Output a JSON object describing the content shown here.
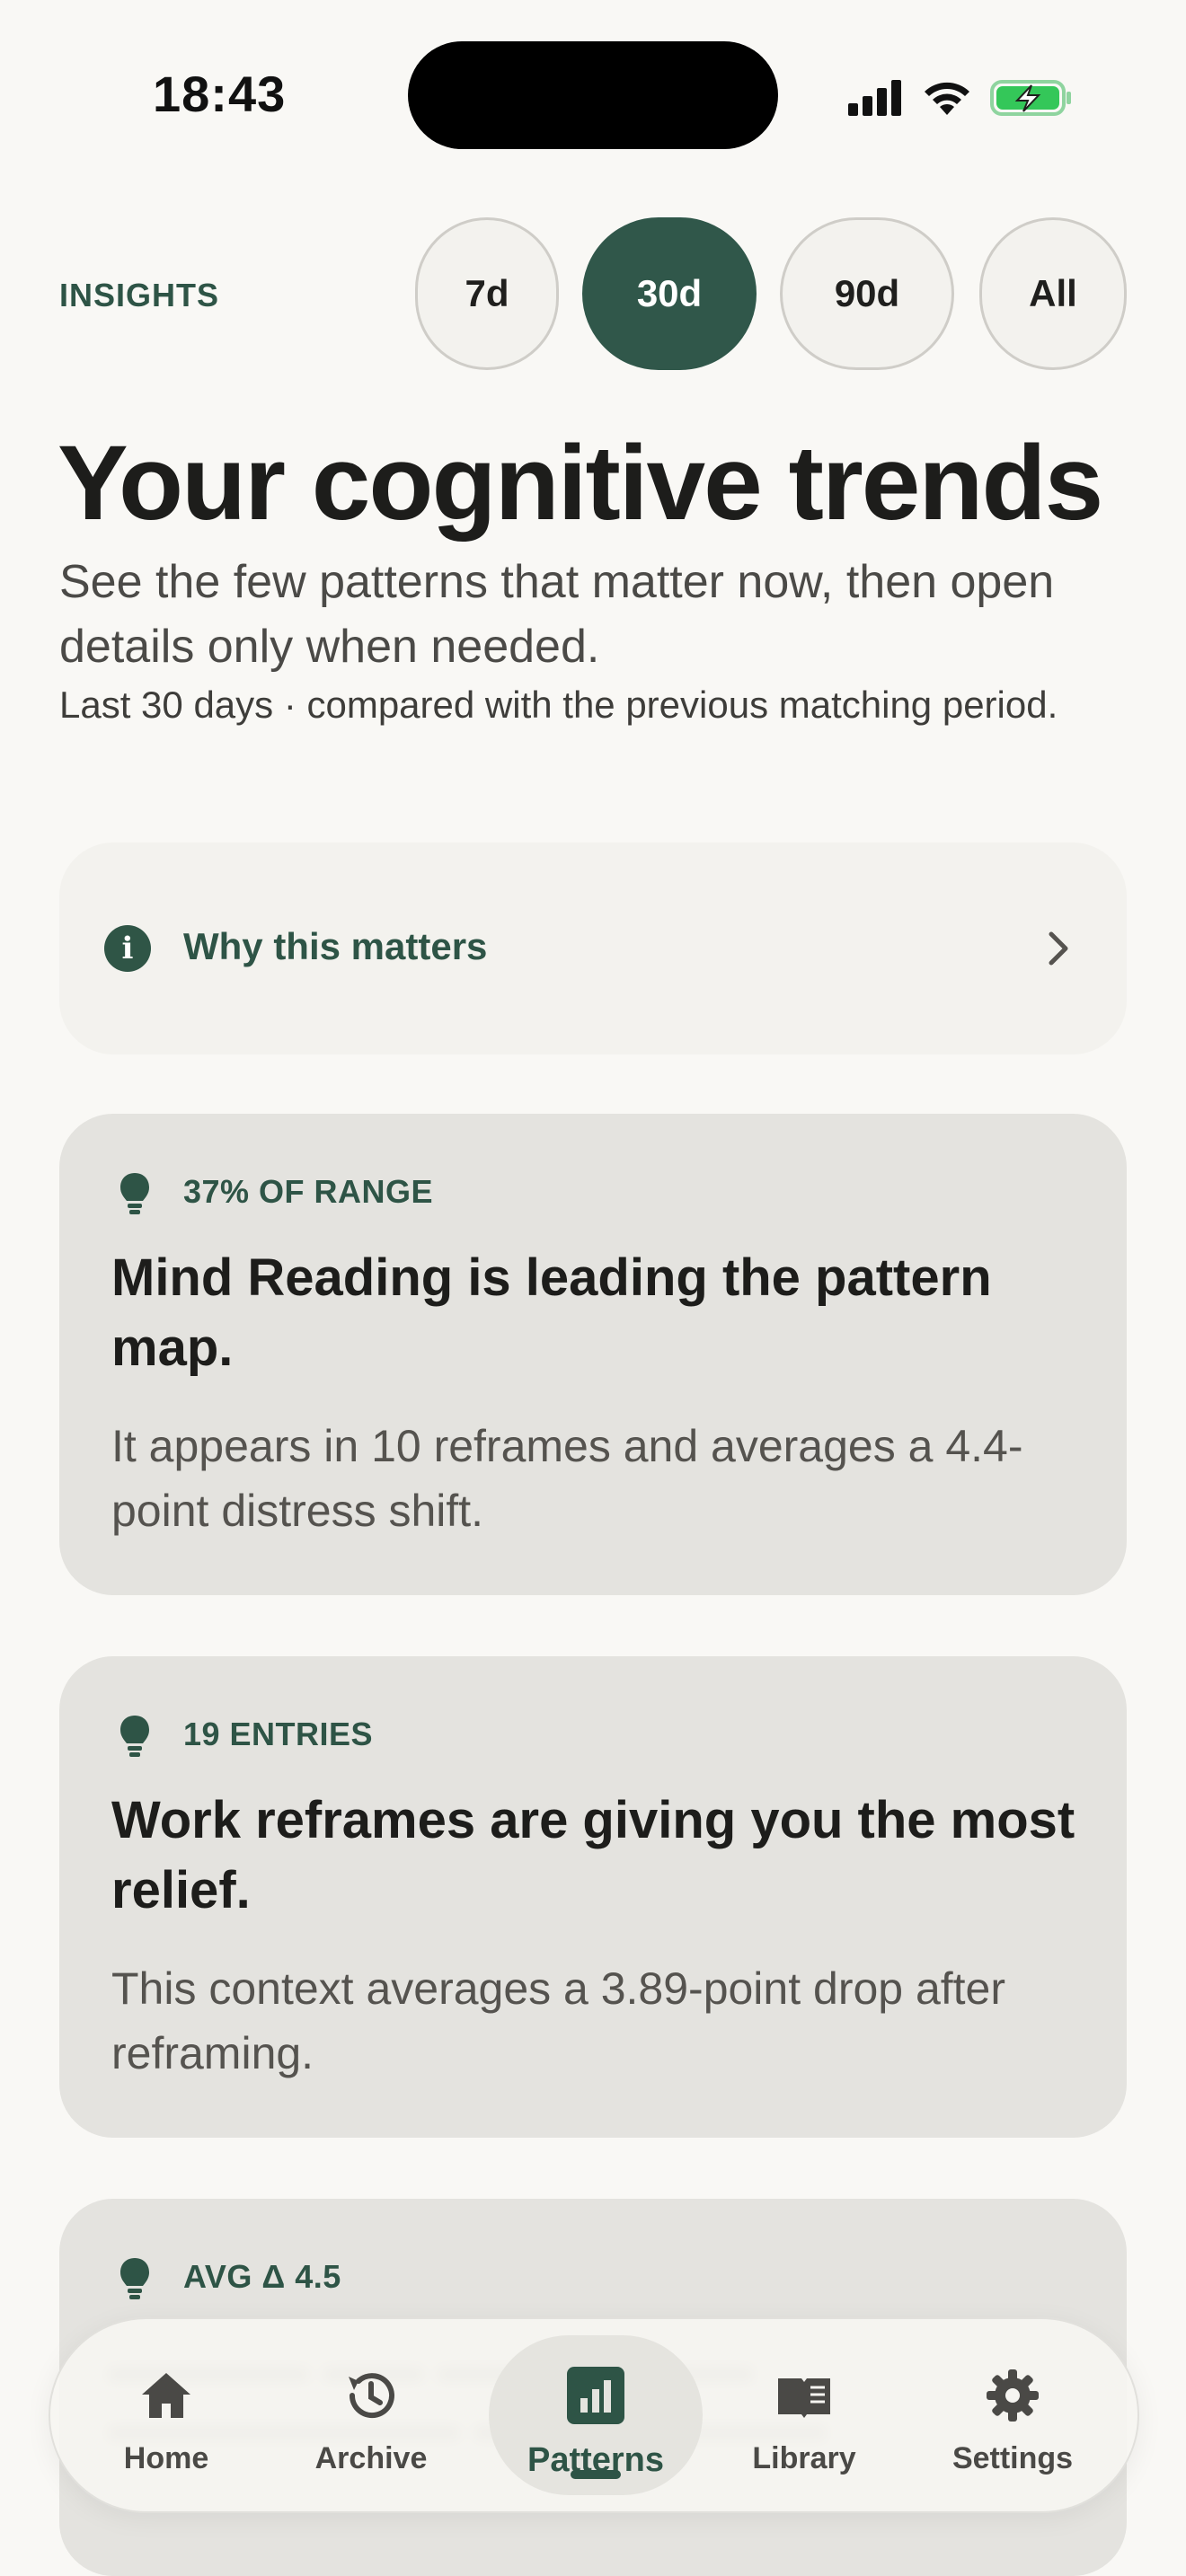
{
  "status_bar": {
    "time": "18:43"
  },
  "header": {
    "eyebrow": "INSIGHTS",
    "ranges": [
      "7d",
      "30d",
      "90d",
      "All"
    ],
    "active_range": "30d"
  },
  "hero": {
    "title": "Your cognitive trends",
    "subtitle": "See the few patterns that matter now, then open details only when needed.",
    "meta": "Last 30 days · compared with the previous matching period."
  },
  "why_card": {
    "label": "Why this matters",
    "icon": "info-icon"
  },
  "insights": [
    {
      "tag": "37% OF RANGE",
      "headline": "Mind Reading is leading the pattern map.",
      "body": "It appears in 10 reframes and averages a 4.4-point distress shift."
    },
    {
      "tag": "19 ENTRIES",
      "headline": "Work reframes are giving you the most relief.",
      "body": "This context averages a 3.89-point drop after reframing."
    },
    {
      "tag": "AVG Δ 4.5",
      "headline": "",
      "body": ""
    }
  ],
  "nav": {
    "items": [
      {
        "label": "Home",
        "icon": "home-icon"
      },
      {
        "label": "Archive",
        "icon": "history-icon"
      },
      {
        "label": "Patterns",
        "icon": "bar-chart-icon"
      },
      {
        "label": "Library",
        "icon": "book-icon"
      },
      {
        "label": "Settings",
        "icon": "gear-icon"
      }
    ],
    "active": "Patterns"
  },
  "colors": {
    "accent": "#30574a",
    "background": "#f9f8f5",
    "card": "#e4e3df",
    "battery": "#34c759"
  }
}
